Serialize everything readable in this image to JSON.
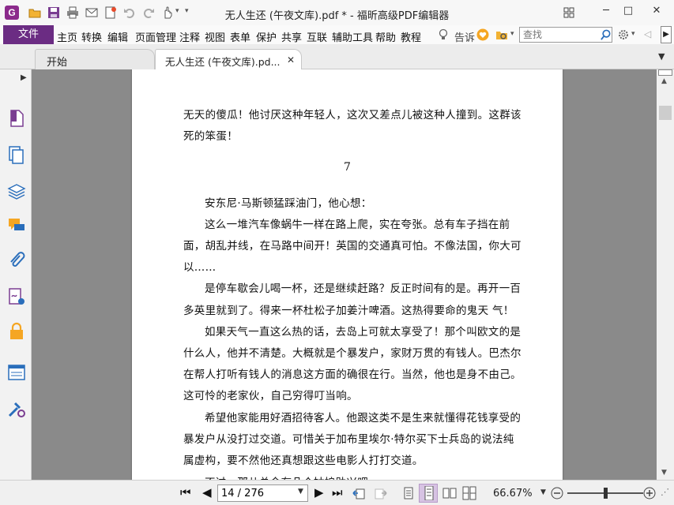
{
  "window": {
    "title": "无人生还 (午夜文库).pdf * - 福昕高级PDF编辑器",
    "app_logo_letter": "G"
  },
  "quick_access": [
    "open-icon",
    "save-icon",
    "print-icon",
    "email-icon",
    "new-icon",
    "undo-icon",
    "redo-icon",
    "hand-tool-icon",
    "dropdown-icon"
  ],
  "menubar": {
    "file_label": "文件",
    "items": [
      "主页",
      "转换",
      "编辑",
      "页面管理",
      "注释",
      "视图",
      "表单",
      "保护",
      "共享",
      "互联",
      "辅助工具",
      "帮助",
      "教程"
    ],
    "tell_me_label": "告诉",
    "search_placeholder": "查找"
  },
  "tabs": [
    {
      "label": "开始"
    },
    {
      "label": "无人生还 (午夜文库).pd...",
      "close": "✕"
    }
  ],
  "sidebar_icons": [
    "page-thumbnail-icon",
    "pages-icon",
    "layers-icon",
    "comments-icon",
    "attachments-icon",
    "signature-icon",
    "security-icon",
    "form-fields-icon",
    "certify-icon"
  ],
  "document": {
    "lines_top": [
      "无天的傻瓜！他讨厌这种年轻人，这次又差点儿被这种人撞到。这群该",
      "死的笨蛋！"
    ],
    "chapter_number": "7",
    "lines_body": [
      "安东尼·马斯顿猛踩油门，他心想：",
      "这么一堆汽车像蜗牛一样在路上爬，实在夸张。总有车子挡在前",
      "面，胡乱并线，在马路中间开！英国的交通真可怕。不像法国，你大可",
      "以……",
      "是停车歇会儿喝一杯，还是继续赶路？反正时间有的是。再开一百",
      "多英里就到了。得来一杯杜松子加姜汁啤酒。这热得要命的鬼天 气！",
      "如果天气一直这么热的话，去岛上可就太享受了！那个叫欧文的是",
      "什么人，他并不清楚。大概就是个暴发户，家财万贯的有钱人。巴杰尔",
      "在帮人打听有钱人的消息这方面的确很在行。当然，他也是身不由己。",
      "这可怜的老家伙，自己穷得叮当响。",
      "希望他家能用好酒招待客人。他跟这类不是生来就懂得花钱享受的",
      "暴发户从没打过交道。可惜关于加布里埃尔·特尔买下士兵岛的说法纯",
      "属虚构，要不然他还真想跟这些电影人打打交道。",
      "不过，那儿总会有几个姑娘助兴吧。"
    ]
  },
  "statusbar": {
    "page_display": "14 / 276",
    "zoom": "66.67%",
    "zoom_slider_fraction": 0.5
  },
  "colors": {
    "brand": "#6b2c83",
    "accent_orange": "#f5a623",
    "icon_purple": "#8b2a8b",
    "icon_blue": "#2a6ebb"
  }
}
